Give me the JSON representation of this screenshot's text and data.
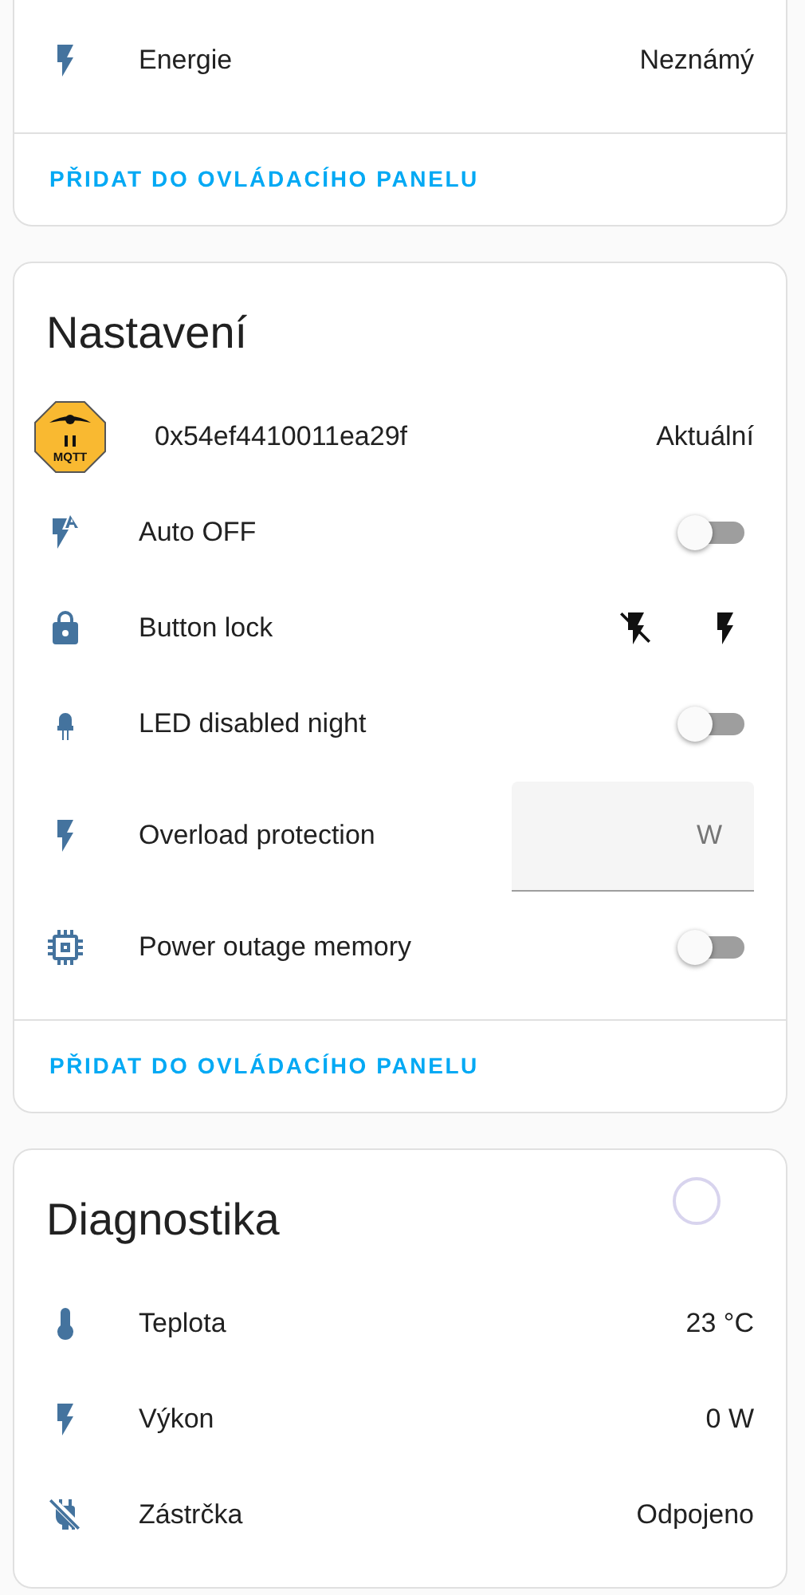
{
  "cards": [
    {
      "rows": [
        {
          "kind": "value",
          "label": "Energie",
          "value": "Neznámý"
        }
      ],
      "action": "PŘIDAT DO OVLÁDACÍHO PANELU"
    },
    {
      "title": "Nastavení",
      "rows": [
        {
          "kind": "logo",
          "logo_text": "MQTT",
          "label": "0x54ef4410011ea29f",
          "value": "Aktuální"
        },
        {
          "kind": "toggle",
          "label": "Auto OFF",
          "on": false
        },
        {
          "kind": "buttons",
          "label": "Button lock"
        },
        {
          "kind": "toggle",
          "label": "LED disabled night",
          "on": false
        },
        {
          "kind": "number",
          "label": "Overload protection",
          "unit": "W"
        },
        {
          "kind": "toggle",
          "label": "Power outage memory",
          "on": false
        }
      ],
      "action": "PŘIDAT DO OVLÁDACÍHO PANELU"
    },
    {
      "title": "Diagnostika",
      "loading": true,
      "rows": [
        {
          "kind": "value",
          "label": "Teplota",
          "value": "23 °C"
        },
        {
          "kind": "value",
          "label": "Výkon",
          "value": "0 W"
        },
        {
          "kind": "value",
          "label": "Zástrčka",
          "value": "Odpojeno"
        }
      ]
    }
  ]
}
